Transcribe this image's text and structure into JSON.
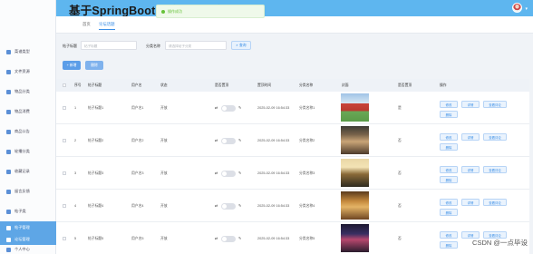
{
  "header": {
    "title": "基于SpringBoot的校园论坛交流网站",
    "toast": "操作成功"
  },
  "sidebar": {
    "items": [
      {
        "label": "菜谱类型"
      },
      {
        "label": "文件资源"
      },
      {
        "label": "物品分类"
      },
      {
        "label": "物品消费"
      },
      {
        "label": "商品公告"
      },
      {
        "label": "轮播分类"
      },
      {
        "label": "收藏记录"
      },
      {
        "label": "留言反馈"
      },
      {
        "label": "帖子类"
      },
      {
        "label": "帖子管理"
      },
      {
        "label": "论坛管理"
      },
      {
        "label": "个人中心"
      }
    ]
  },
  "tabs": [
    {
      "label": "首页"
    },
    {
      "label": "论坛话题"
    }
  ],
  "search": {
    "title_label": "帖子标题",
    "title_placeholder": "帖子标题",
    "category_label": "分类名称",
    "category_placeholder": "请选择帖子分类",
    "query_button": "查询"
  },
  "actions": {
    "add": "+ 新增",
    "delete": "删除"
  },
  "table": {
    "columns": [
      "",
      "序号",
      "帖子标题",
      "用户名",
      "状态",
      "是否置顶",
      "置顶时间",
      "分类名称",
      "封面",
      "是否置顶",
      "操作"
    ],
    "rows": [
      {
        "index": "1",
        "title": "帖子标题1",
        "user": "用户名1",
        "status": "开放",
        "time": "2025-02-09 16:54:33",
        "category": "分类名称1",
        "top": "是"
      },
      {
        "index": "2",
        "title": "帖子标题2",
        "user": "用户名2",
        "status": "开放",
        "time": "2025-02-09 16:54:33",
        "category": "分类名称2",
        "top": "否"
      },
      {
        "index": "3",
        "title": "帖子标题3",
        "user": "用户名3",
        "status": "开放",
        "time": "2025-02-09 16:54:33",
        "category": "分类名称3",
        "top": "否"
      },
      {
        "index": "4",
        "title": "帖子标题4",
        "user": "用户名4",
        "status": "开放",
        "time": "2025-02-09 16:54:33",
        "category": "分类名称4",
        "top": "否"
      },
      {
        "index": "5",
        "title": "帖子标题5",
        "user": "用户名5",
        "status": "开放",
        "time": "2025-02-09 16:54:33",
        "category": "分类名称5",
        "top": "否"
      }
    ],
    "op_buttons": [
      "修改",
      "详情",
      "查看评论",
      "删除"
    ]
  },
  "watermark": "CSDN @一点毕设",
  "colors": {
    "header": "#5eb6ef",
    "accent": "#3a8ee6",
    "sidebar_active": "#5ea6e6",
    "toast_text": "#67c23a"
  }
}
